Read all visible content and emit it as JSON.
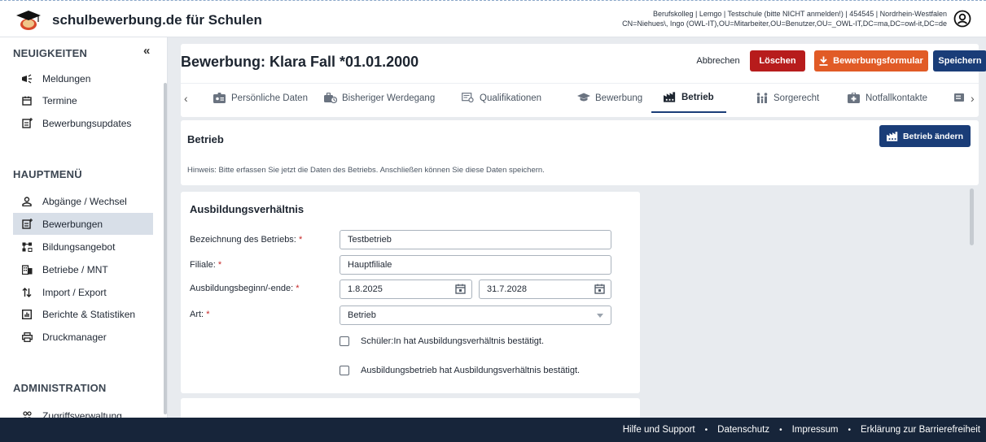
{
  "header": {
    "app_title": "schulbewerbung.de für Schulen",
    "context_line1": "Berufskolleg | Lemgo | Testschule (bitte NICHT anmelden!) | 454545 | Nordrhein-Westfalen",
    "context_line2": "CN=Niehues\\, Ingo (OWL-IT),OU=Mitarbeiter,OU=Benutzer,OU=_OWL-IT,DC=ma,DC=owl-it,DC=de",
    "user_icon": "user-circle-icon"
  },
  "sidebar": {
    "news_heading": "NEUIGKEITEN",
    "collapse_symbol": "«",
    "news_items": [
      {
        "label": "Meldungen",
        "icon": "megaphone-icon"
      },
      {
        "label": "Termine",
        "icon": "calendar-icon"
      },
      {
        "label": "Bewerbungsupdates",
        "icon": "updates-icon"
      }
    ],
    "main_heading": "HAUPTMENÜ",
    "main_items": [
      {
        "label": "Abgänge / Wechsel",
        "icon": "person-icon"
      },
      {
        "label": "Bewerbungen",
        "icon": "applications-icon",
        "active": true
      },
      {
        "label": "Bildungsangebot",
        "icon": "sitemap-icon"
      },
      {
        "label": "Betriebe / MNT",
        "icon": "building-icon"
      },
      {
        "label": "Import / Export",
        "icon": "import-export-icon"
      },
      {
        "label": "Berichte & Statistiken",
        "icon": "chart-icon"
      },
      {
        "label": "Druckmanager",
        "icon": "printer-icon"
      }
    ],
    "admin_heading": "ADMINISTRATION",
    "admin_items": [
      {
        "label": "Zugriffsverwaltung",
        "icon": "users-icon"
      }
    ]
  },
  "page": {
    "title": "Bewerbung: Klara Fall *01.01.2000",
    "buttons": {
      "cancel": "Abbrechen",
      "delete": "Löschen",
      "form": "Bewerbungsformular",
      "save": "Speichern"
    },
    "tabs": [
      {
        "label": "Persönliche Daten",
        "icon": "id-card-icon"
      },
      {
        "label": "Bisheriger Werdegang",
        "icon": "career-icon"
      },
      {
        "label": "Qualifikationen",
        "icon": "certificate-icon"
      },
      {
        "label": "Bewerbung",
        "icon": "graduation-cap-icon"
      },
      {
        "label": "Betrieb",
        "icon": "industry-icon",
        "active": true
      },
      {
        "label": "Sorgerecht",
        "icon": "family-icon"
      },
      {
        "label": "Notfallkontakte",
        "icon": "first-aid-icon"
      }
    ]
  },
  "betrieb": {
    "title": "Betrieb",
    "change_button": "Betrieb ändern",
    "hint": "Hinweis: Bitte erfassen Sie jetzt die Daten des Betriebs. Anschließen können Sie diese Daten speichern."
  },
  "form": {
    "title": "Ausbildungsverhältnis",
    "required_marker": "*",
    "fields": {
      "company_name": {
        "label": "Bezeichnung des Betriebs:",
        "value": "Testbetrieb"
      },
      "branch": {
        "label": "Filiale:",
        "value": "Hauptfiliale"
      },
      "period": {
        "label": "Ausbildungsbeginn/-ende:",
        "start": "1.8.2025",
        "end": "31.7.2028"
      },
      "type": {
        "label": "Art:",
        "value": "Betrieb"
      }
    },
    "checkboxes": {
      "student_confirmed": {
        "label": "Schüler:In hat Ausbildungsverhältnis bestätigt.",
        "checked": false
      },
      "company_confirmed": {
        "label": "Ausbildungsbetrieb hat Ausbildungsverhältnis bestätigt.",
        "checked": false
      }
    }
  },
  "footer": {
    "links": [
      "Hilfe und Support",
      "Datenschutz",
      "Impressum",
      "Erklärung zur Barrierefreiheit"
    ],
    "separator": "•"
  },
  "colors": {
    "navy": "#1a3d78",
    "red": "#b71c1c",
    "orange": "#e15b26",
    "footer_bg": "#17253a",
    "active_nav": "#d8dfe8"
  }
}
